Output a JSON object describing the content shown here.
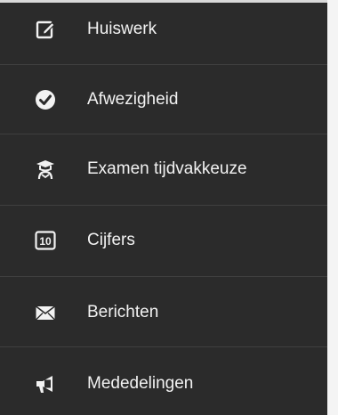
{
  "menu": {
    "items": [
      {
        "label": "Huiswerk",
        "icon": "edit-icon"
      },
      {
        "label": "Afwezigheid",
        "icon": "check-circle-icon"
      },
      {
        "label": "Examen tijdvakkeuze",
        "icon": "graduate-icon"
      },
      {
        "label": "Cijfers",
        "icon": "grade-10-icon",
        "icon_text": "10"
      },
      {
        "label": "Berichten",
        "icon": "envelope-icon"
      },
      {
        "label": "Mededelingen",
        "icon": "megaphone-icon"
      }
    ]
  },
  "colors": {
    "drawer_background": "#2b2b2b",
    "text": "#f2f2f2",
    "divider": "#3f3f3f"
  }
}
